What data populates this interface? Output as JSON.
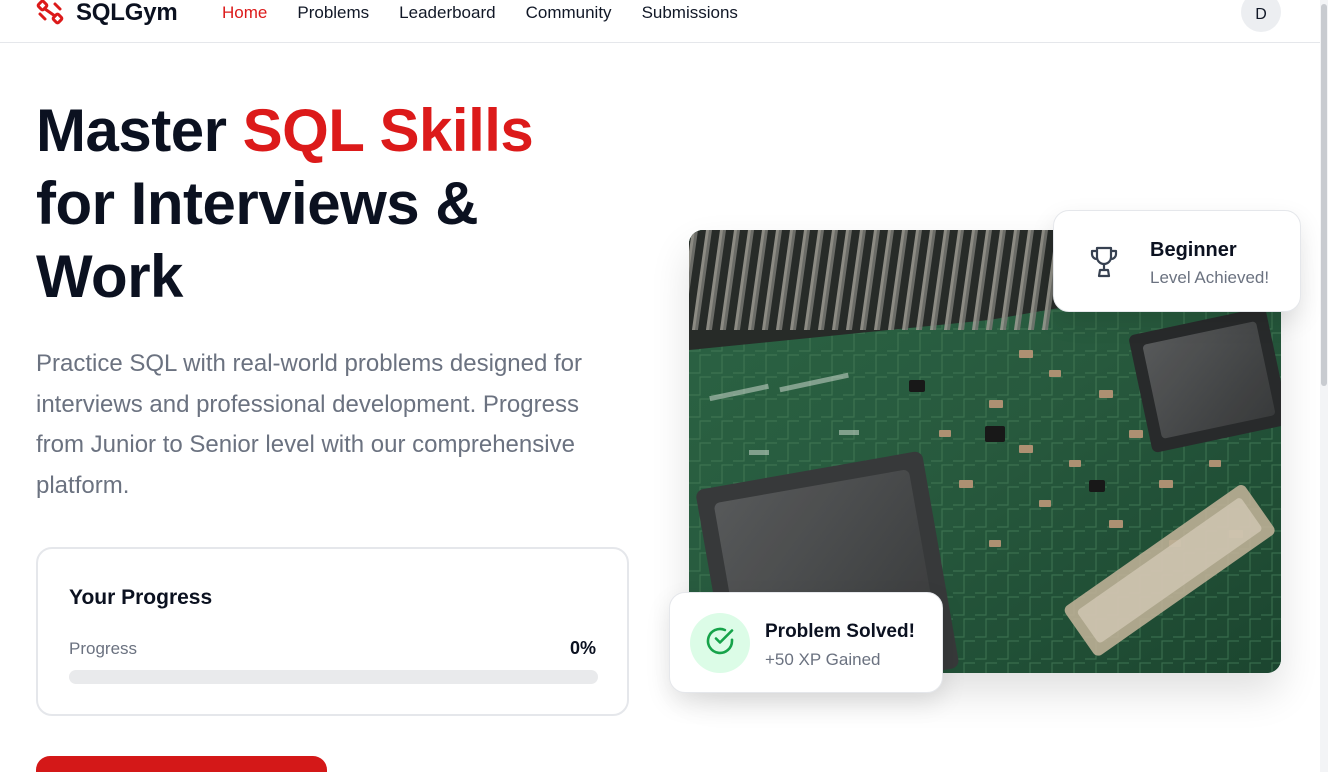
{
  "brand": {
    "name": "SQLGym",
    "accent_color": "#dc1a1a",
    "logo_icon": "dumbbell-icon"
  },
  "nav": {
    "items": [
      {
        "label": "Home",
        "active": true
      },
      {
        "label": "Problems",
        "active": false
      },
      {
        "label": "Leaderboard",
        "active": false
      },
      {
        "label": "Community",
        "active": false
      },
      {
        "label": "Submissions",
        "active": false
      }
    ]
  },
  "user": {
    "avatar_initial": "D"
  },
  "hero": {
    "title_part1": "Master ",
    "title_accent": "SQL Skills",
    "title_part2": "for Interviews & Work",
    "description": "Practice SQL with real-world problems designed for interviews and professional development. Progress from Junior to Senior level with our comprehensive platform."
  },
  "progress_card": {
    "title": "Your Progress",
    "label": "Progress",
    "value_text": "0%",
    "value": 0
  },
  "hero_image": {
    "subject": "circuit-board-photo"
  },
  "achievement_card": {
    "icon": "trophy-icon",
    "title": "Beginner",
    "subtitle": "Level Achieved!"
  },
  "solved_card": {
    "icon": "check-circle-icon",
    "icon_bg": "#dcfce7",
    "icon_color": "#16a34a",
    "title": "Problem Solved!",
    "subtitle": "+50 XP Gained"
  }
}
